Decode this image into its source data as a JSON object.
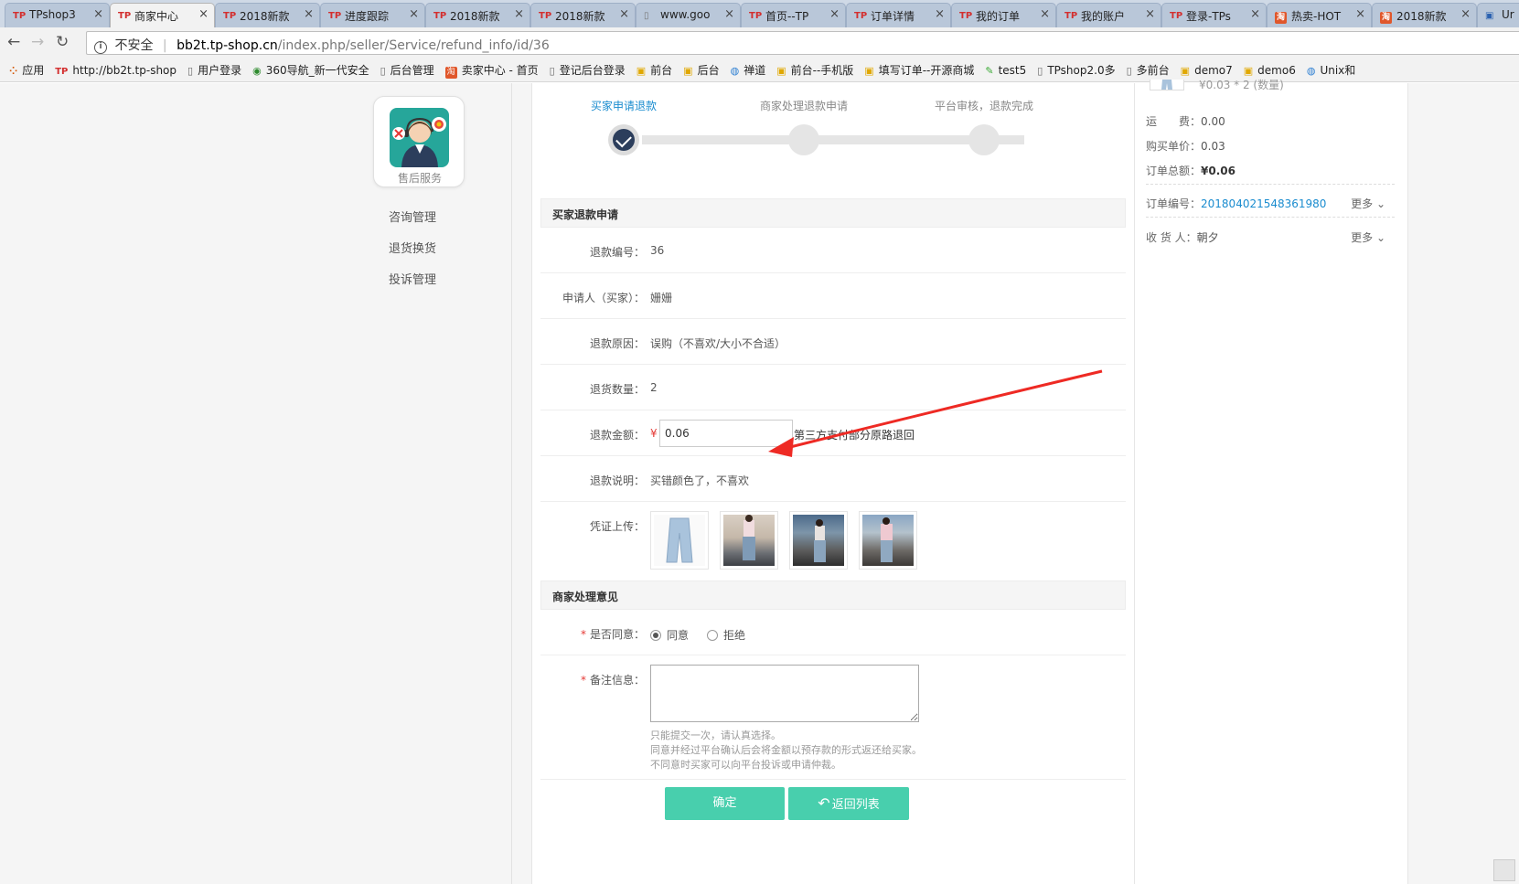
{
  "browser": {
    "tabs": [
      {
        "icon": "TP",
        "label": "TPshop3"
      },
      {
        "icon": "TP",
        "label": "商家中心",
        "active": true
      },
      {
        "icon": "TP",
        "label": "2018新款"
      },
      {
        "icon": "TP",
        "label": "进度跟踪"
      },
      {
        "icon": "TP",
        "label": "2018新款"
      },
      {
        "icon": "TP",
        "label": "2018新款"
      },
      {
        "icon": "doc",
        "label": "www.goo"
      },
      {
        "icon": "TP",
        "label": "首页--TP"
      },
      {
        "icon": "TP",
        "label": "订单详情"
      },
      {
        "icon": "TP",
        "label": "我的订单"
      },
      {
        "icon": "TP",
        "label": "我的账户"
      },
      {
        "icon": "TP",
        "label": "登录-TPs"
      },
      {
        "icon": "tb",
        "label": "热卖-HOT"
      },
      {
        "icon": "tb",
        "label": "2018新款"
      },
      {
        "icon": "ext",
        "label": "Ur"
      }
    ],
    "close_glyph": "×",
    "nav": {
      "back": "←",
      "forward": "→",
      "reload": "↻"
    },
    "address": {
      "security_label": "不安全",
      "host": "bb2t.tp-shop.cn",
      "path": "/index.php/seller/Service/refund_info/id/36"
    },
    "bookmarks": [
      {
        "icon": "grid",
        "label": "应用"
      },
      {
        "icon": "tp",
        "label": "http://bb2t.tp-shop"
      },
      {
        "icon": "doc",
        "label": "用户登录"
      },
      {
        "icon": "g360",
        "label": "360导航_新一代安全"
      },
      {
        "icon": "doc",
        "label": "后台管理"
      },
      {
        "icon": "tb",
        "label": "卖家中心 - 首页"
      },
      {
        "icon": "doc",
        "label": "登记后台登录"
      },
      {
        "icon": "bag",
        "label": "前台"
      },
      {
        "icon": "bag",
        "label": "后台"
      },
      {
        "icon": "globe",
        "label": "禅道"
      },
      {
        "icon": "bag",
        "label": "前台--手机版"
      },
      {
        "icon": "bag",
        "label": "填写订单--开源商城"
      },
      {
        "icon": "leaf",
        "label": "test5"
      },
      {
        "icon": "doc",
        "label": "TPshop2.0多"
      },
      {
        "icon": "doc",
        "label": "多前台"
      },
      {
        "icon": "bag",
        "label": "demo7"
      },
      {
        "icon": "bag",
        "label": "demo6"
      },
      {
        "icon": "globe",
        "label": "Unix和"
      }
    ]
  },
  "sidebar": {
    "service_label": "售后服务",
    "menu": [
      "咨询管理",
      "退货换货",
      "投诉管理"
    ]
  },
  "steps": {
    "items": [
      "买家申请退款",
      "商家处理退款申请",
      "平台审核，退款完成"
    ],
    "current": 0,
    "check_glyph": "✓"
  },
  "refund": {
    "section_title": "买家退款申请",
    "fields": {
      "id_label": "退款编号：",
      "id_value": "36",
      "applicant_label": "申请人（买家）：",
      "applicant_value": "姗姗",
      "reason_label": "退款原因：",
      "reason_value": "误购（不喜欢/大小不合适）",
      "qty_label": "退货数量：",
      "qty_value": "2",
      "amount_label": "退款金额：",
      "currency": "¥",
      "amount_value": "0.06",
      "amount_note": "第三方支付部分原路退回",
      "desc_label": "退款说明：",
      "desc_value": "买错颜色了，不喜欢",
      "proof_label": "凭证上传："
    }
  },
  "seller": {
    "section_title": "商家处理意见",
    "agree_label": "是否同意：",
    "required_mark": "*",
    "options": [
      "同意",
      "拒绝"
    ],
    "selected": 0,
    "remark_label": "备注信息：",
    "remark_value": "",
    "hints": [
      "只能提交一次，请认真选择。",
      "同意并经过平台确认后会将金额以预存款的形式返还给买家。",
      "不同意时买家可以向平台投诉或申请仲裁。"
    ]
  },
  "actions": {
    "confirm": "确定",
    "back_icon": "↶",
    "back": "返回列表"
  },
  "order": {
    "price_qty": "¥0.03 * 2 (数量)",
    "shipping_label": "运　　费：",
    "shipping_value": "0.00",
    "unit_price_label": "购买单价：",
    "unit_price_value": "0.03",
    "total_label": "订单总额：",
    "total_value": "¥0.06",
    "order_no_label": "订单编号：",
    "order_no_value": "201804021548361980",
    "more": "更多 ⌄",
    "receiver_label": "收 货 人：",
    "receiver_value": "朝夕"
  },
  "colors": {
    "primary_button": "#48cfad",
    "link_blue": "#1a8ccf",
    "required_red": "#e53935",
    "annotation_arrow": "#ee2a24",
    "step_done": "#2c3e5c"
  }
}
